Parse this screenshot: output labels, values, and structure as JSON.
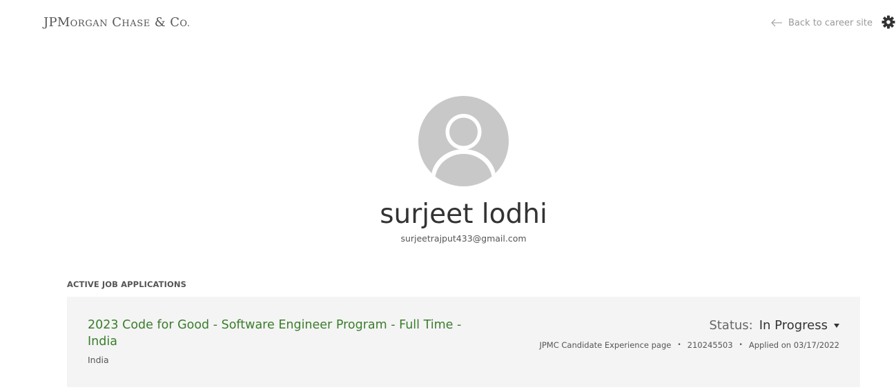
{
  "header": {
    "logo": {
      "jp": "JPM",
      "organ": "ORGAN",
      "c": "C",
      "hase": "HASE",
      "amp": " & ",
      "co_c": "C",
      "co_rest": "O."
    },
    "back_link_label": "Back to career site",
    "back_icon": "arrow-left-icon",
    "settings_icon": "gear-icon"
  },
  "profile": {
    "avatar_icon": "user-silhouette-icon",
    "name": "surjeet lodhi",
    "email": "surjeetrajput433@gmail.com"
  },
  "applications": {
    "heading": "ACTIVE JOB APPLICATIONS",
    "items": [
      {
        "title": "2023 Code for Good - Software Engineer Program - Full Time - India",
        "location": "India",
        "status_label": "Status:",
        "status_value": "In Progress",
        "source": "JPMC Candidate Experience page",
        "separator": "•",
        "job_id": "210245503",
        "applied_on": "Applied on 03/17/2022"
      }
    ]
  },
  "colors": {
    "job_title": "#3a7d2b",
    "card_background": "#f4f4f4",
    "avatar_fill": "#c8c8c8"
  }
}
